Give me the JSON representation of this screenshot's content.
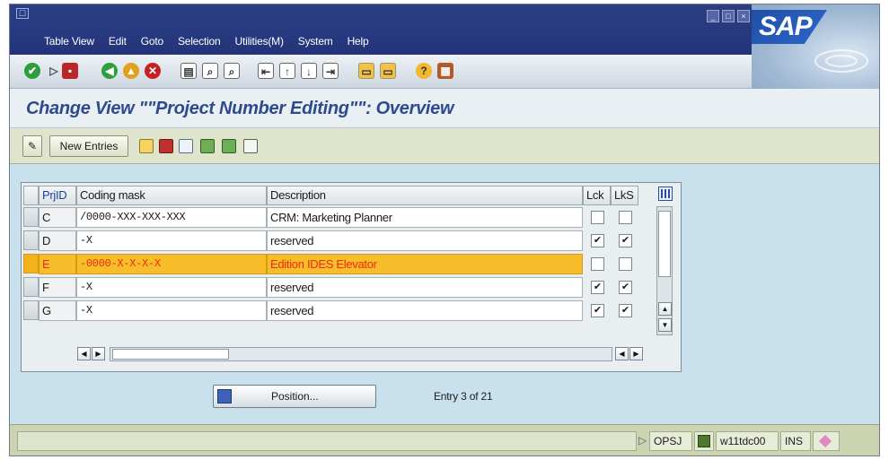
{
  "window": {
    "menu": [
      "Table View",
      "Edit",
      "Goto",
      "Selection",
      "Utilities(M)",
      "System",
      "Help"
    ],
    "logo_text": "SAP"
  },
  "title": {
    "text": "Change View \"\"Project Number Editing\"\": Overview"
  },
  "app_toolbar": {
    "new_entries_label": "New Entries"
  },
  "table": {
    "columns": [
      "PrjID",
      "Coding mask",
      "Description",
      "Lck",
      "LkS"
    ],
    "rows": [
      {
        "prjid": "C",
        "mask": "/0000-XXX-XXX-XXX",
        "description": "CRM: Marketing Planner",
        "lck": false,
        "lks": false,
        "selected": false
      },
      {
        "prjid": "D",
        "mask": "-X",
        "description": "reserved",
        "lck": true,
        "lks": true,
        "selected": false
      },
      {
        "prjid": "E",
        "mask": "-0000-X-X-X-X",
        "description": "Edition IDES Elevator",
        "lck": false,
        "lks": false,
        "selected": true
      },
      {
        "prjid": "F",
        "mask": "-X",
        "description": "reserved",
        "lck": true,
        "lks": true,
        "selected": false
      },
      {
        "prjid": "G",
        "mask": "-X",
        "description": "reserved",
        "lck": true,
        "lks": true,
        "selected": false
      }
    ]
  },
  "position_button": {
    "label": "Position..."
  },
  "entry_info": "Entry 3 of 21",
  "status": {
    "transaction": "OPSJ",
    "server": "w11tdc00",
    "mode": "INS"
  },
  "colors": {
    "title_blue": "#2e4a8e",
    "highlight_row": "#f8bd2a",
    "highlight_text": "#f02a10",
    "content_bg": "#c9e1ec"
  }
}
